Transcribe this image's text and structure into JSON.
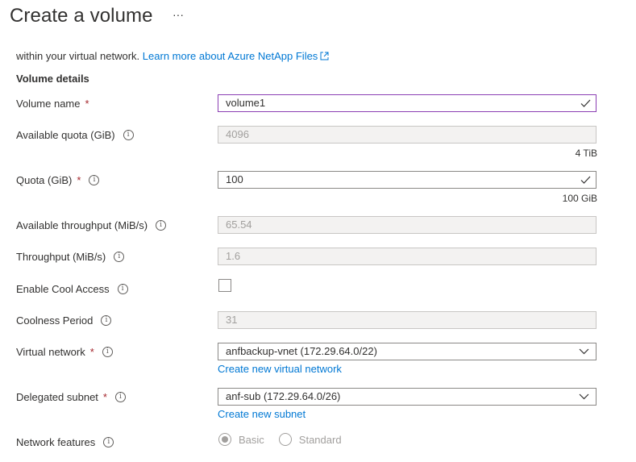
{
  "page": {
    "title": "Create a volume",
    "more_label": "···"
  },
  "intro": {
    "text": "within your virtual network.",
    "link_text": "Learn more about Azure NetApp Files"
  },
  "section_title": "Volume details",
  "fields": {
    "volume_name": {
      "label": "Volume name",
      "required": "*",
      "value": "volume1"
    },
    "available_quota": {
      "label": "Available quota (GiB)",
      "value": "4096",
      "hint": "4 TiB"
    },
    "quota": {
      "label": "Quota (GiB)",
      "required": "*",
      "value": "100",
      "hint": "100 GiB"
    },
    "available_throughput": {
      "label": "Available throughput (MiB/s)",
      "value": "65.54"
    },
    "throughput": {
      "label": "Throughput (MiB/s)",
      "value": "1.6"
    },
    "cool_access": {
      "label": "Enable Cool Access",
      "checked": false
    },
    "coolness_period": {
      "label": "Coolness Period",
      "value": "31"
    },
    "virtual_network": {
      "label": "Virtual network",
      "required": "*",
      "value": "anfbackup-vnet (172.29.64.0/22)",
      "link": "Create new virtual network"
    },
    "delegated_subnet": {
      "label": "Delegated subnet",
      "required": "*",
      "value": "anf-sub (172.29.64.0/26)",
      "link": "Create new subnet"
    },
    "network_features": {
      "label": "Network features",
      "options": [
        "Basic",
        "Standard"
      ],
      "selected": "Basic"
    }
  },
  "icons": {
    "info": "info-icon",
    "check": "checkmark-icon",
    "chevron": "chevron-down-icon",
    "external": "external-link-icon"
  },
  "colors": {
    "link": "#0078d4",
    "required": "#a4262c",
    "focus_border": "#8b3fb3",
    "disabled_bg": "#f3f2f1"
  }
}
